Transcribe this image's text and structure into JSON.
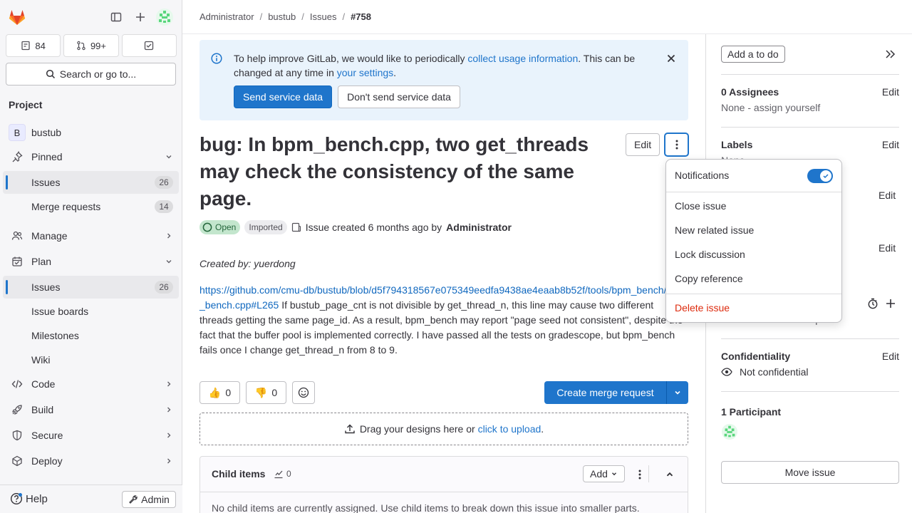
{
  "sidebar": {
    "counters": [
      {
        "icon": "issues-icon",
        "value": "84"
      },
      {
        "icon": "merge-request-icon",
        "value": "99+"
      },
      {
        "icon": "todo-icon",
        "value": ""
      }
    ],
    "search_label": "Search or go to...",
    "section_title": "Project",
    "project_initial": "B",
    "project_name": "bustub",
    "pinned_label": "Pinned",
    "pinned_issues_label": "Issues",
    "pinned_issues_count": "26",
    "pinned_mr_label": "Merge requests",
    "pinned_mr_count": "14",
    "manage_label": "Manage",
    "plan_label": "Plan",
    "plan_issues_label": "Issues",
    "plan_issues_count": "26",
    "issue_boards_label": "Issue boards",
    "milestones_label": "Milestones",
    "wiki_label": "Wiki",
    "code_label": "Code",
    "build_label": "Build",
    "secure_label": "Secure",
    "deploy_label": "Deploy",
    "help_label": "Help",
    "admin_label": "Admin"
  },
  "breadcrumb": {
    "items": [
      "Administrator",
      "bustub",
      "Issues"
    ],
    "current": "#758"
  },
  "banner": {
    "text_before": "To help improve GitLab, we would like to periodically ",
    "link1": "collect usage information",
    "text_mid": ". This can be changed at any time in ",
    "link2": "your settings",
    "text_after": ".",
    "send_label": "Send service data",
    "dont_send_label": "Don't send service data"
  },
  "issue": {
    "title": "bug: In bpm_bench.cpp, two get_threads may check the consistency of the same page.",
    "edit_label": "Edit",
    "status": "Open",
    "imported": "Imported",
    "created_text": "Issue created 6 months ago by",
    "author": "Administrator",
    "created_by": "Created by: yuerdong",
    "link": "https://github.com/cmu-db/bustub/blob/d5f794318567e075349eedfa9438ae4eaab8b52f/tools/bpm_bench/bpm_bench.cpp#L265",
    "body": " If bustub_page_cnt is not divisible by get_thread_n, this line may cause two different threads getting the same page_id. As a result, bpm_bench may report \"page seed not consistent\", despite the fact that the buffer pool is implemented correctly. I have passed all the tests on gradescope, but bpm_bench fails once I change get_thread_n from 8 to 9.",
    "thumbs_up": "👍",
    "thumbs_up_count": "0",
    "thumbs_down": "👎",
    "thumbs_down_count": "0",
    "create_mr_label": "Create merge request",
    "upload_text": "Drag your designs here or ",
    "upload_link": "click to upload",
    "upload_after": ".",
    "child_items_label": "Child items",
    "child_items_count": "0",
    "child_add_label": "Add",
    "child_empty_text": "No child items are currently assigned. Use child items to break down this issue into smaller parts."
  },
  "dropdown": {
    "notifications_label": "Notifications",
    "notifications_on": true,
    "close_issue": "Close issue",
    "new_related": "New related issue",
    "lock": "Lock discussion",
    "copy_ref": "Copy reference",
    "delete": "Delete issue"
  },
  "right_sidebar": {
    "todo_label": "Add a to do",
    "assignees_title": "0 Assignees",
    "assignees_value": "None - assign yourself",
    "labels_title": "Labels",
    "labels_value": "None",
    "time_value": "No estimate or time spent",
    "confidentiality_title": "Confidentiality",
    "confidentiality_value": "Not confidential",
    "participants_title": "1 Participant",
    "edit_label": "Edit",
    "move_issue_label": "Move issue"
  },
  "colors": {
    "accent": "#1f75cb",
    "danger": "#dd2b0e",
    "open_bg": "#c3e6cd"
  }
}
